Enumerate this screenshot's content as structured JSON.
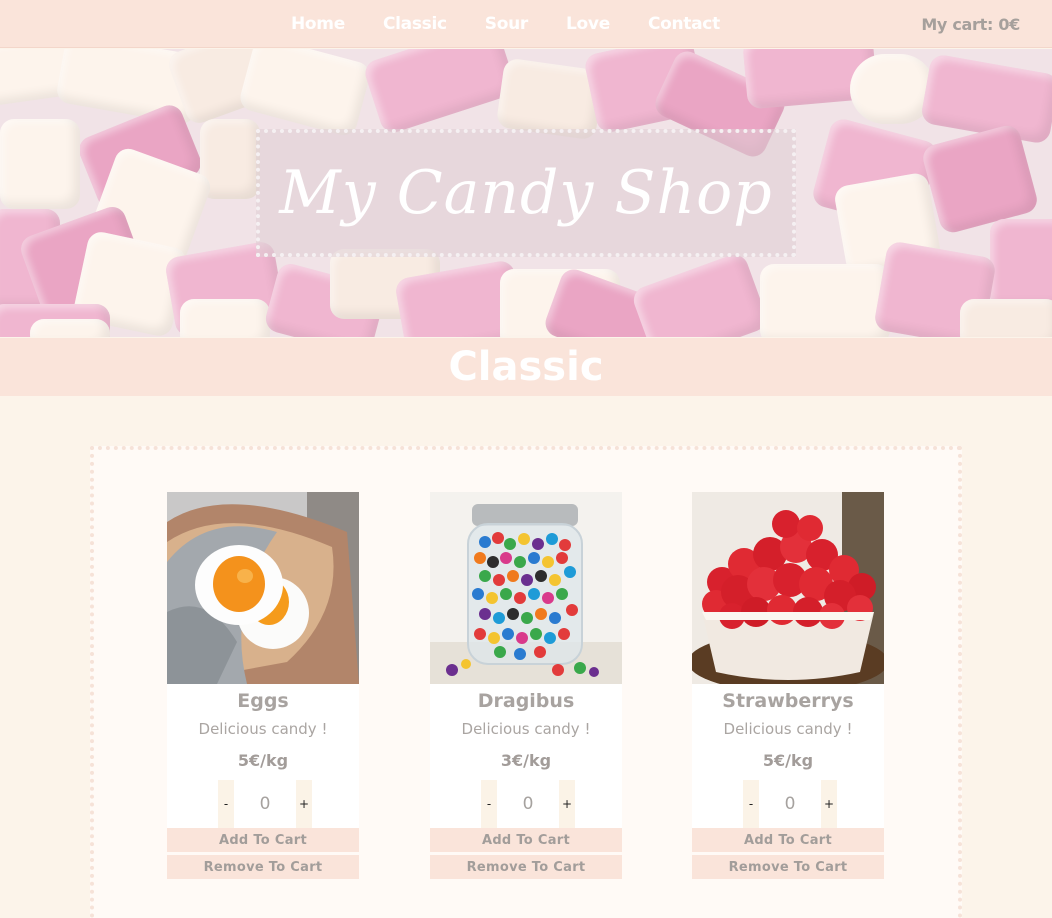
{
  "nav": {
    "links": [
      "Home",
      "Classic",
      "Sour",
      "Love",
      "Contact"
    ],
    "cart_label": "My cart: 0€"
  },
  "hero": {
    "title": "My Candy Shop"
  },
  "section": {
    "title": "Classic"
  },
  "products": [
    {
      "name": "Eggs",
      "description": "Delicious candy !",
      "price": "5€/kg",
      "quantity": "0",
      "minus": "-",
      "plus": "+",
      "add_label": "Add To Cart",
      "remove_label": "Remove To Cart",
      "image_icon": "fried-egg-candy-image"
    },
    {
      "name": "Dragibus",
      "description": "Delicious candy !",
      "price": "3€/kg",
      "quantity": "0",
      "minus": "-",
      "plus": "+",
      "add_label": "Add To Cart",
      "remove_label": "Remove To Cart",
      "image_icon": "jelly-bean-jar-image"
    },
    {
      "name": "Strawberrys",
      "description": "Delicious candy !",
      "price": "5€/kg",
      "quantity": "0",
      "minus": "-",
      "plus": "+",
      "add_label": "Add To Cart",
      "remove_label": "Remove To Cart",
      "image_icon": "strawberry-candy-bowl-image"
    }
  ],
  "colors": {
    "nav_bg": "#fae4da",
    "page_bg": "#fcf4ea",
    "text": "#a8a3a0"
  }
}
